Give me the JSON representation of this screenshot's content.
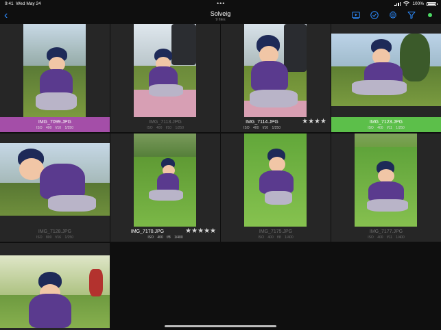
{
  "status_bar": {
    "time": "9:41",
    "date": "Wed May 24",
    "battery": "100%",
    "more_dots": "•••"
  },
  "navbar": {
    "title": "Solveig",
    "subtitle": "9 files"
  },
  "colors": {
    "purple_label": "#a44ea8",
    "green_label": "#5cbf4a",
    "accent": "#2d8cff",
    "dot_green": "#4cd964"
  },
  "photos": [
    {
      "file": "IMG_7099.JPG",
      "iso": "ISO 400",
      "aperture": "f/10",
      "shutter": "1/250",
      "label": "purple",
      "stars": ""
    },
    {
      "file": "IMG_7113.JPG",
      "iso": "ISO 400",
      "aperture": "f/10",
      "shutter": "1/250",
      "label": "none",
      "stars": ""
    },
    {
      "file": "IMG_7114.JPG",
      "iso": "ISO 400",
      "aperture": "f/10",
      "shutter": "1/250",
      "label": "none",
      "stars": "★★★★"
    },
    {
      "file": "IMG_7123.JPG",
      "iso": "ISO 400",
      "aperture": "f/11",
      "shutter": "1/250",
      "label": "green",
      "stars": ""
    },
    {
      "file": "IMG_7128.JPG",
      "iso": "ISO 800",
      "aperture": "f/16",
      "shutter": "1/250",
      "label": "none",
      "stars": ""
    },
    {
      "file": "IMG_7170.JPG",
      "iso": "ISO 400",
      "aperture": "f/8",
      "shutter": "1/400",
      "label": "none",
      "stars": "★★★★★"
    },
    {
      "file": "IMG_7175.JPG",
      "iso": "ISO 400",
      "aperture": "f/8",
      "shutter": "1/400",
      "label": "none",
      "stars": ""
    },
    {
      "file": "IMG_7177.JPG",
      "iso": "ISO 400",
      "aperture": "f/11",
      "shutter": "1/400",
      "label": "none",
      "stars": ""
    },
    {
      "file": "",
      "iso": "",
      "aperture": "",
      "shutter": "",
      "label": "none",
      "stars": ""
    }
  ]
}
